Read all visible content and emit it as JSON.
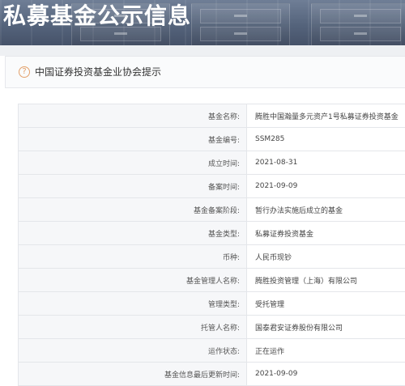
{
  "header": {
    "title": "私募基金公示信息"
  },
  "notice": {
    "icon": "question-circle-icon",
    "text": "中国证券投资基金业协会提示"
  },
  "fund_info": {
    "rows": [
      {
        "label": "基金名称:",
        "value": "腾胜中国瀚量多元资产1号私募证券投资基金"
      },
      {
        "label": "基金编号:",
        "value": "SSM285"
      },
      {
        "label": "成立时间:",
        "value": "2021-08-31"
      },
      {
        "label": "备案时间:",
        "value": "2021-09-09"
      },
      {
        "label": "基金备案阶段:",
        "value": "暂行办法实施后成立的基金"
      },
      {
        "label": "基金类型:",
        "value": "私募证券投资基金"
      },
      {
        "label": "币种:",
        "value": "人民币现钞"
      },
      {
        "label": "基金管理人名称:",
        "value": "腾胜投资管理（上海）有限公司"
      },
      {
        "label": "管理类型:",
        "value": "受托管理"
      },
      {
        "label": "托管人名称:",
        "value": "国泰君安证券股份有限公司"
      },
      {
        "label": "运作状态:",
        "value": "正在运作"
      },
      {
        "label": "基金信息最后更新时间:",
        "value": "2021-09-09"
      }
    ]
  },
  "colors": {
    "banner": "#55647c",
    "notice_icon": "#e3a06a",
    "label_bg": "#f6f7f9",
    "border": "#e4e6ea"
  }
}
